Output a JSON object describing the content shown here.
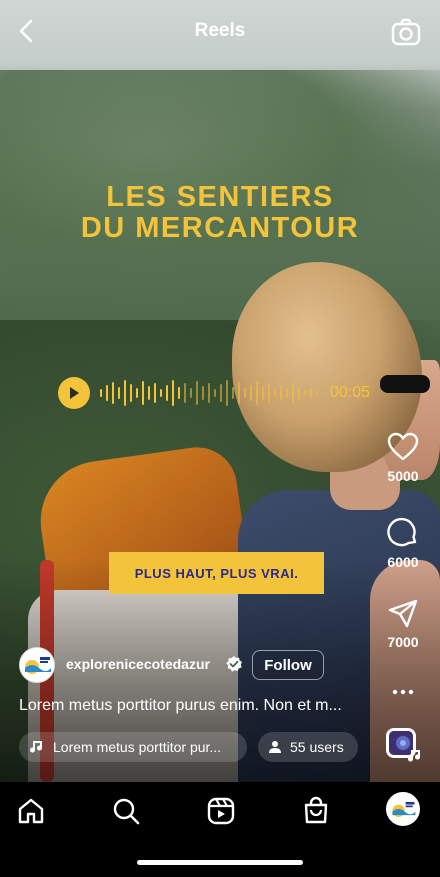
{
  "header": {
    "title": "Reels",
    "back_icon": "chevron-left-icon",
    "camera_icon": "camera-icon"
  },
  "post": {
    "headline_line1": "LES SENTIERS",
    "headline_line2": "DU MERCANTOUR",
    "audio_time": "00:05",
    "banner": "PLUS HAUT, PLUS VRAI.",
    "username": "explorenicecotedazur",
    "verified": true,
    "follow_label": "Follow",
    "caption": "Lorem metus porttitor purus enim. Non et m...",
    "music": "Lorem metus porttitor pur...",
    "users": "55 users"
  },
  "actions": {
    "likes": "5000",
    "comments": "6000",
    "shares": "7000"
  },
  "nav": [
    "home-icon",
    "search-icon",
    "reels-icon",
    "shop-icon",
    "profile-avatar"
  ],
  "colors": {
    "accent_yellow": "#f3c43a",
    "banner_text": "#2a2a8a"
  }
}
